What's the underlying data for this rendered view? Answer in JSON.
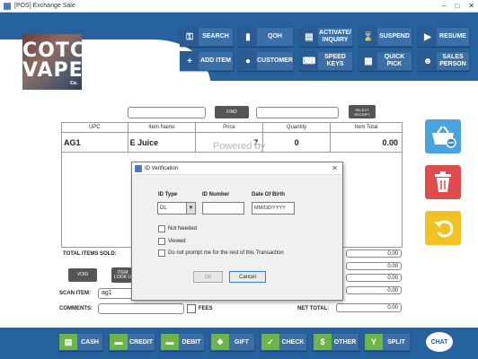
{
  "window": {
    "title": "[POS] Exchange Sale"
  },
  "logo": {
    "text_line1": "COTC",
    "text_line2": "VAPE",
    "sub": "Co."
  },
  "toolbar_row1": [
    {
      "label": "SEARCH",
      "icon": "key-icon"
    },
    {
      "label": "QOH",
      "icon": "bar-chart-icon"
    },
    {
      "label": "ACTIVATE/ INQUIRY",
      "icon": "card-icon"
    },
    {
      "label": "SUSPEND",
      "icon": "hourglass-icon"
    },
    {
      "label": "RESUME",
      "icon": "play-icon"
    }
  ],
  "toolbar_row2": [
    {
      "label": "ADD ITEM",
      "icon": "plus-icon"
    },
    {
      "label": "CUSTOMER",
      "icon": "person-icon"
    },
    {
      "label": "SPEED KEYS",
      "icon": "keyboard-icon"
    },
    {
      "label": "QUICK PICK",
      "icon": "grid-icon"
    },
    {
      "label": "SALES PERSON",
      "icon": "salesperson-icon"
    }
  ],
  "find": {
    "button": "FIND",
    "select_receipt": "SELECT RECEIPT"
  },
  "grid": {
    "columns": [
      "UPC",
      "Item Name",
      "Price",
      "Quantity",
      "Item Total"
    ],
    "rows": [
      {
        "upc": "AG1",
        "name": "E Juice",
        "price": "7.",
        "qty": "0",
        "total": "0.00"
      }
    ],
    "watermark": "Powered by"
  },
  "totals": {
    "items_sold_label": "TOTAL ITEMS SOLD:",
    "values": [
      "0.00",
      "0.00",
      "0.00",
      "0.00",
      "0.00"
    ],
    "void_label": "VOID",
    "lookup_label": "ITEM LOOK U"
  },
  "scan": {
    "label": "SCAN ITEM:",
    "value": "ag1"
  },
  "comments": {
    "label": "COMMENTS:",
    "value": ""
  },
  "fees": {
    "label": "FEES"
  },
  "net_total": {
    "label": "NET TOTAL:",
    "value": "0.00"
  },
  "payments": [
    {
      "label": "CASH",
      "icon": "cash-icon"
    },
    {
      "label": "CREDIT",
      "icon": "credit-card-icon"
    },
    {
      "label": "DEBIT",
      "icon": "debit-card-icon"
    },
    {
      "label": "GIFT",
      "icon": "gift-icon"
    },
    {
      "label": "CHECK",
      "icon": "check-icon"
    },
    {
      "label": "OTHER",
      "icon": "dollar-icon"
    },
    {
      "label": "SPLIT",
      "icon": "split-icon"
    }
  ],
  "chat": {
    "label": "CHAT"
  },
  "dialog": {
    "title": "ID Verification",
    "id_type_label": "ID Type",
    "id_type_value": "DL",
    "id_number_label": "ID Number",
    "id_number_value": "",
    "dob_label": "Date Of Birth",
    "dob_placeholder": "MM/DD/YYYY",
    "options": [
      "Not Needed",
      "Viewed",
      "Do not prompt me for the rest of this Transaction"
    ],
    "ok_label": "Ok",
    "cancel_label": "Cancel"
  },
  "colors": {
    "header_blue": "#26629d",
    "button_blue": "#3a6fa8",
    "basket_blue": "#4aa3df",
    "trash_red": "#e04b4b",
    "undo_yellow": "#f3c026",
    "pay_icon_green": "#6db54a"
  }
}
